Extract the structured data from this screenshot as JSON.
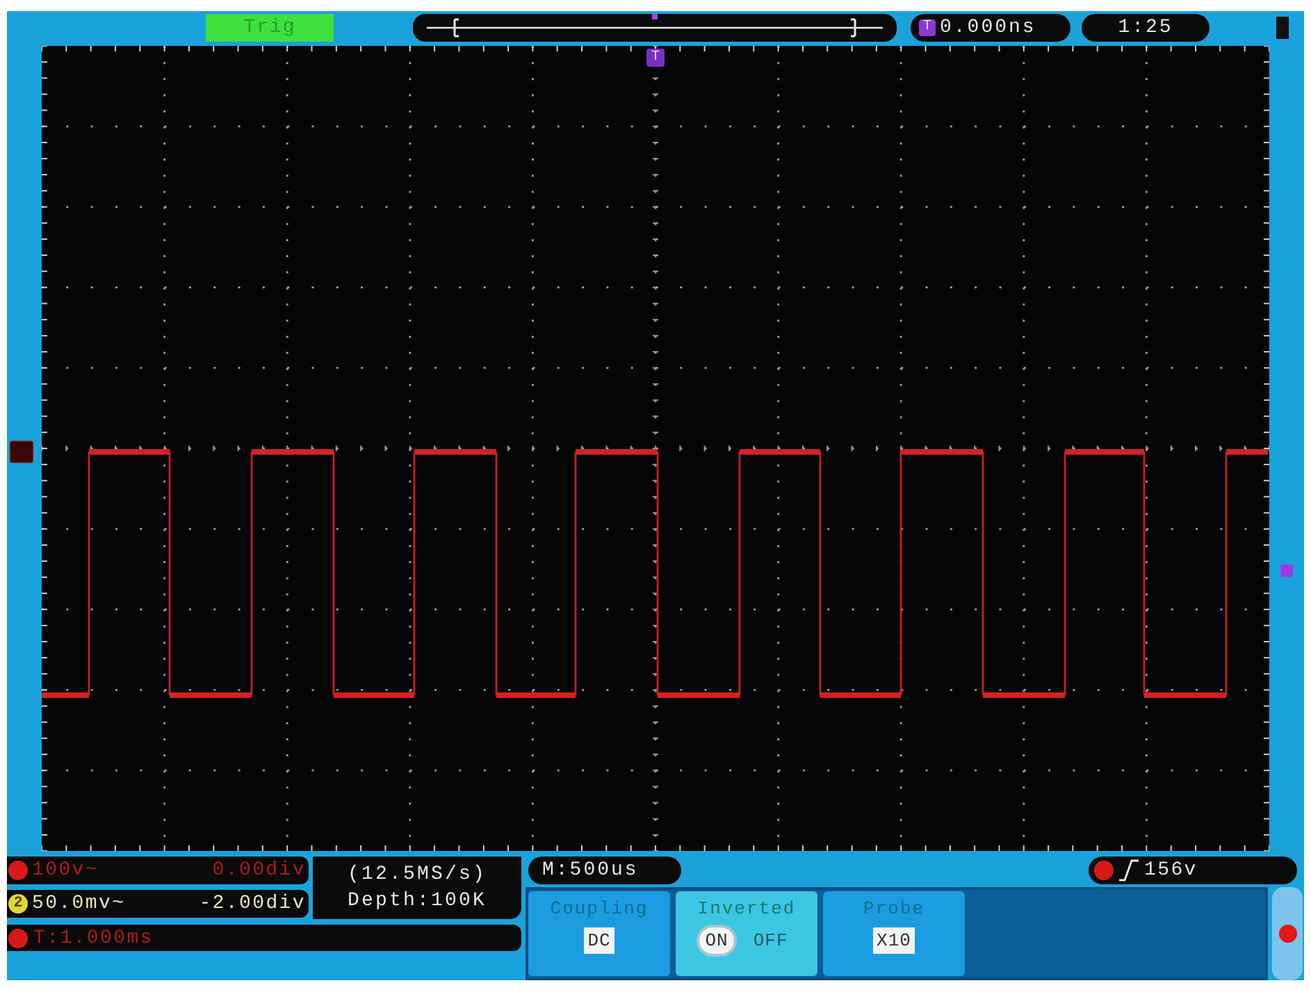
{
  "top_bar": {
    "trigger_status": "Trig",
    "offset_marker": "T",
    "time_offset": "0.000ns",
    "clock": "1:25"
  },
  "screen": {
    "trigger_marker": "T"
  },
  "channels": [
    {
      "scale": "100v~",
      "position": "0.00div",
      "color": "#d81818"
    },
    {
      "number": "2",
      "scale": "50.0mv~",
      "position": "-2.00div",
      "color": "#e0d830"
    }
  ],
  "acquisition": {
    "sample_rate": "(12.5MS/s)",
    "depth": "Depth:100K"
  },
  "trigger_time": "T:1.000ms",
  "timebase": "M:500us",
  "trigger_level": "156v",
  "menu": [
    {
      "kind": "value",
      "title": "Coupling",
      "value": "DC",
      "selected": false
    },
    {
      "kind": "toggle",
      "title": "Inverted",
      "selected": true,
      "options": [
        {
          "label": "ON",
          "selected": true
        },
        {
          "label": "OFF",
          "selected": false
        }
      ]
    },
    {
      "kind": "value",
      "title": "Probe",
      "value": "X10",
      "selected": false
    }
  ]
}
